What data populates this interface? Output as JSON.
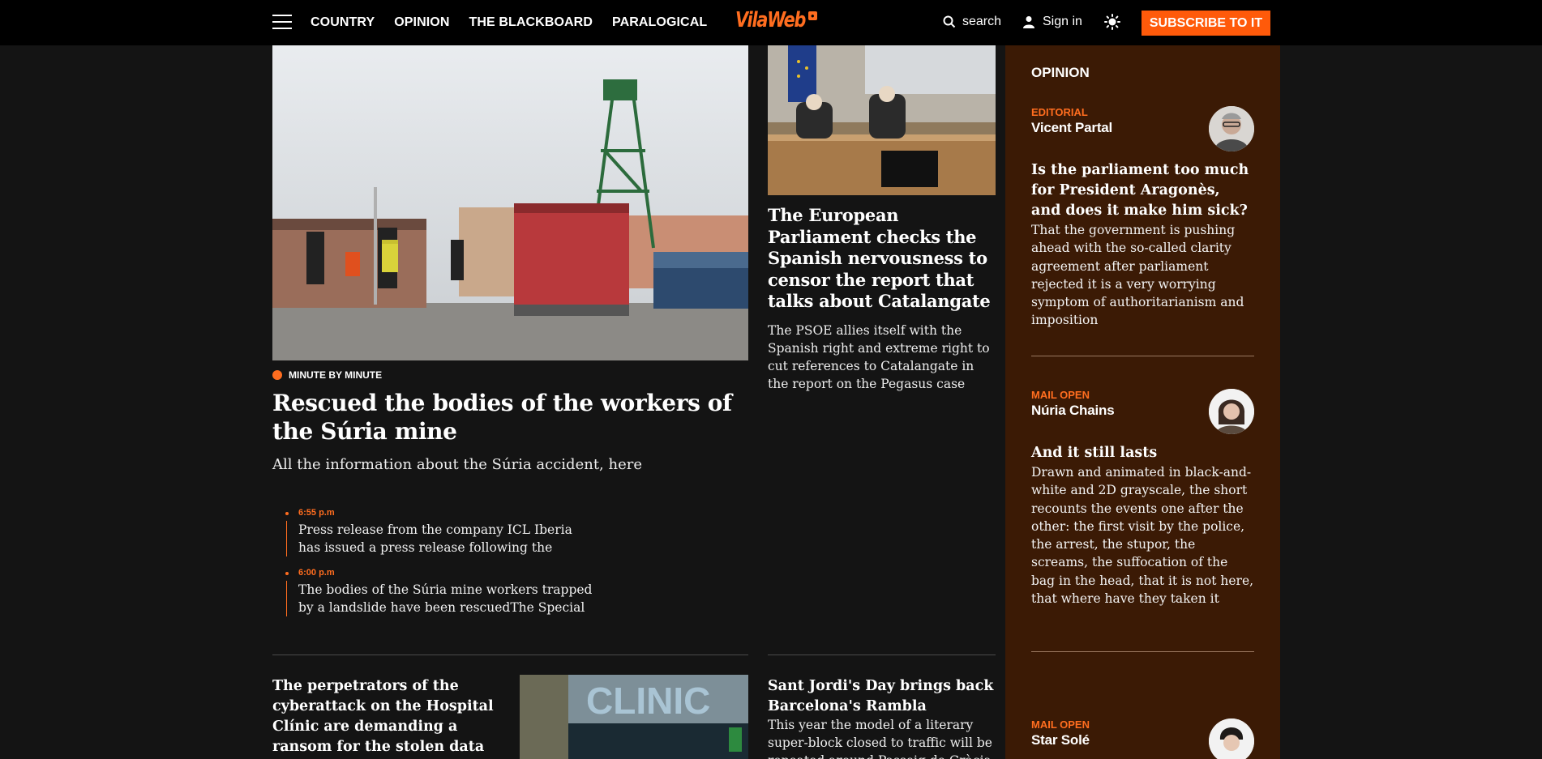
{
  "header": {
    "nav": [
      "COUNTRY",
      "OPINION",
      "THE BLACKBOARD",
      "PARALOGICAL"
    ],
    "logo": "VilaWeb",
    "search_label": "search",
    "signin_label": "Sign in",
    "subscribe_label": "SUBSCRIBE TO IT"
  },
  "lead": {
    "tag": "MINUTE BY MINUTE",
    "title": "Rescued the bodies of the workers of the Súria mine",
    "subtitle": "All the information about the Súria accident, here",
    "updates": [
      {
        "time": "6:55 p.m",
        "text": "Press release from the company ICL Iberia has issued a press release following the accident at…"
      },
      {
        "time": "6:00 p.m",
        "text": "The bodies of the Súria mine workers trapped by a landslide have been rescuedThe Special Actio…"
      }
    ]
  },
  "secondary": {
    "title": "The European Parliament checks the Spanish nervousness to censor the report that talks about Catalangate",
    "subtitle": "The PSOE allies itself with the Spanish right and extreme right to cut references to Catalangate in the report on the Pegasus case"
  },
  "bottom": {
    "left_title": "The perpetrators of the cyberattack on the Hospital Clínic are demanding a ransom for the stolen data",
    "clinic_sign": "CLINIC",
    "right_title": "Sant Jordi's Day brings back Barcelona's Rambla",
    "right_sub": "This year the model of a literary super-block closed to traffic will be repeated around Passeig de Gràcia"
  },
  "opinion": {
    "heading": "OPINION",
    "items": [
      {
        "kicker": "EDITORIAL",
        "author": "Vicent Partal",
        "title": "Is the parliament too much for President Aragonès, and does it make him sick?",
        "text": "That the government is pushing ahead with the so-called clarity agreement after parliament rejected it is a very worrying symptom of authoritarianism and imposition"
      },
      {
        "kicker": "MAIL OPEN",
        "author": "Núria Chains",
        "title": "And it still lasts",
        "text": "Drawn and animated in black-and-white and 2D grayscale, the short recounts the events one after the other: the first visit by the police, the arrest, the stupor, the screams, the suffocation of the bag in the head, that it is not here, that where have they taken it"
      },
      {
        "kicker": "MAIL OPEN",
        "author": "Star Solé"
      }
    ]
  },
  "colors": {
    "accent": "#ff6d1f",
    "subscribe": "#ff5a0a",
    "sidebar": "#3b1a05",
    "background": "#141414"
  }
}
